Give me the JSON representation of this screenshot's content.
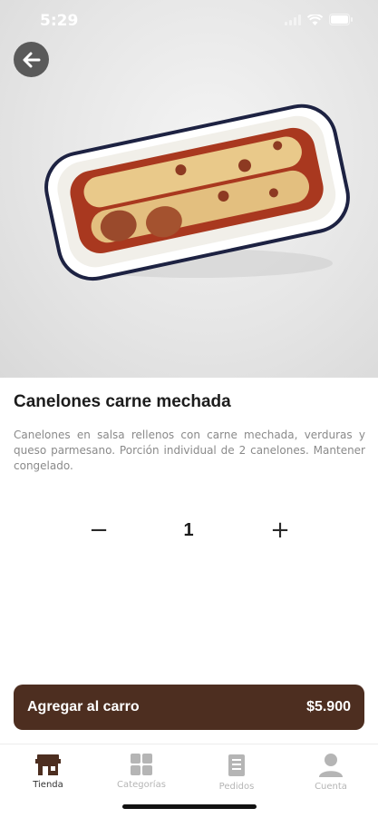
{
  "status_bar": {
    "time": "5:29"
  },
  "product": {
    "title": "Canelones carne mechada",
    "description": "Canelones en salsa rellenos con carne mechada, verduras y queso parmesano. Porción individual de 2 canelones. Mantener congelado."
  },
  "quantity": {
    "value": "1",
    "minus_symbol": "−",
    "plus_symbol": "+"
  },
  "cart_button": {
    "label": "Agregar al carro",
    "price": "$5.900"
  },
  "tabbar": {
    "items": [
      {
        "label": "Tienda",
        "icon": "store-icon",
        "active": true
      },
      {
        "label": "Categorías",
        "icon": "grid-icon",
        "active": false
      },
      {
        "label": "Pedidos",
        "icon": "receipt-icon",
        "active": false
      },
      {
        "label": "Cuenta",
        "icon": "user-icon",
        "active": false
      }
    ]
  },
  "colors": {
    "accent": "#4d2e20",
    "active_tab": "#4d2e20",
    "inactive_tab": "#b5b5b5"
  }
}
